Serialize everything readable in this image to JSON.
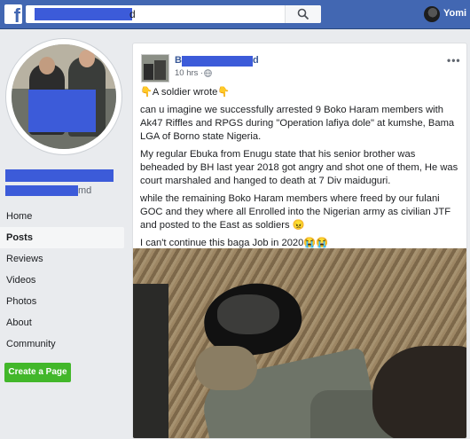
{
  "topbar": {
    "logo": "f",
    "search_value_suffix": "d",
    "search_icon": "search-icon",
    "user_name": "Yomi"
  },
  "profile": {
    "username_suffix": "md"
  },
  "nav": {
    "items": [
      {
        "label": "Home",
        "active": false
      },
      {
        "label": "Posts",
        "active": true
      },
      {
        "label": "Reviews",
        "active": false
      },
      {
        "label": "Videos",
        "active": false
      },
      {
        "label": "Photos",
        "active": false
      },
      {
        "label": "About",
        "active": false
      },
      {
        "label": "Community",
        "active": false
      }
    ],
    "create_page_label": "Create a Page"
  },
  "post": {
    "author_first": "B",
    "author_last": "d",
    "time": "10 hrs · ",
    "more_icon": "more-icon",
    "paragraphs": [
      "👇A soldier wrote👇",
      "can u imagine we successfully arrested 9 Boko Haram members with Ak47 Riffles and RPGS during \"Operation lafiya dole\" at kumshe, Bama LGA of Borno state Nigeria.",
      "My regular Ebuka from Enugu state that his senior brother was beheaded by BH last year 2018 got angry and shot one of them, He was court marshaled and hanged to death at 7 Div maiduguri.",
      "while the remaining Boko Haram members where freed by our fulani GOC and they where all Enrolled into the Nigerian army as civilian JTF and posted to the East as soldiers 😠",
      "I can't continue this baga Job in 2020😭😭"
    ]
  },
  "colors": {
    "topbar": "#4267b2",
    "link": "#385898",
    "redaction": "#3c5bd9",
    "create_page": "#42b72a"
  }
}
